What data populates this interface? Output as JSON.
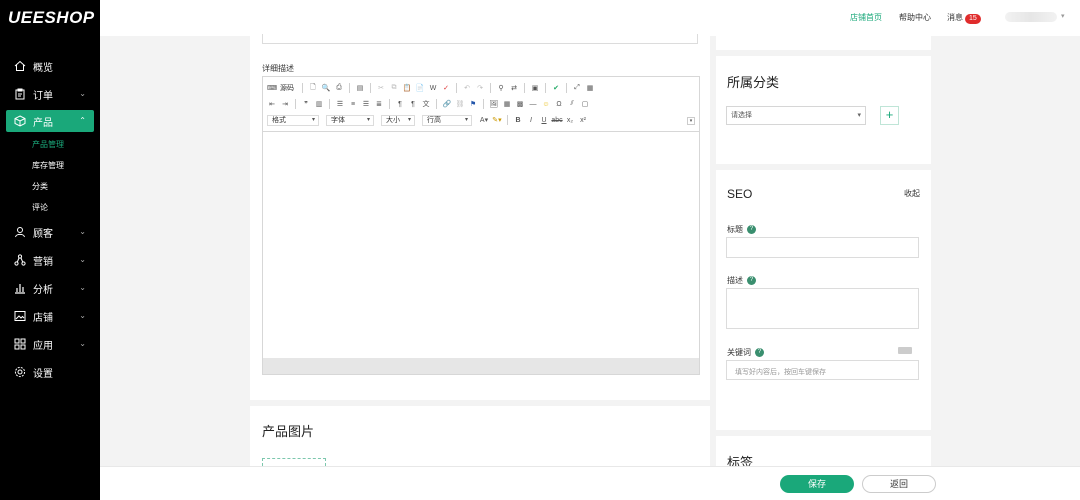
{
  "app": {
    "logo": "UEESHOP"
  },
  "topbar": {
    "store_home": "店铺首页",
    "help_center": "帮助中心",
    "messages": "消息",
    "message_count": "15"
  },
  "sidebar": {
    "items": [
      {
        "label": "概览",
        "icon": "home-icon",
        "has_chevron": false
      },
      {
        "label": "订单",
        "icon": "clipboard-icon",
        "has_chevron": true
      },
      {
        "label": "产品",
        "icon": "box-icon",
        "has_chevron": true,
        "active": true
      },
      {
        "label": "顾客",
        "icon": "user-icon",
        "has_chevron": true
      },
      {
        "label": "营销",
        "icon": "network-icon",
        "has_chevron": true
      },
      {
        "label": "分析",
        "icon": "bar-chart-icon",
        "has_chevron": true
      },
      {
        "label": "店铺",
        "icon": "image-icon",
        "has_chevron": true
      },
      {
        "label": "应用",
        "icon": "apps-icon",
        "has_chevron": true
      },
      {
        "label": "设置",
        "icon": "gear-icon",
        "has_chevron": false
      }
    ],
    "product_sub": [
      "产品管理",
      "库存管理",
      "分类",
      "评论"
    ]
  },
  "editor": {
    "label": "详细描述",
    "source_label": "源码",
    "combos": [
      "格式",
      "字体",
      "大小",
      "行高"
    ]
  },
  "images": {
    "title": "产品图片"
  },
  "category": {
    "title": "所属分类",
    "select_placeholder": "请选择",
    "add_symbol": "+"
  },
  "seo": {
    "title": "SEO",
    "collapse": "收起",
    "title_label": "标题",
    "desc_label": "描述",
    "keywords_label": "关键词",
    "keywords_placeholder": "填写好内容后，按回车键保存"
  },
  "tags": {
    "title": "标签"
  },
  "actions": {
    "save": "保存",
    "back": "返回"
  },
  "colors": {
    "accent": "#1aa87a",
    "sidebar_bg": "#000000",
    "badge": "#e02c2c"
  }
}
